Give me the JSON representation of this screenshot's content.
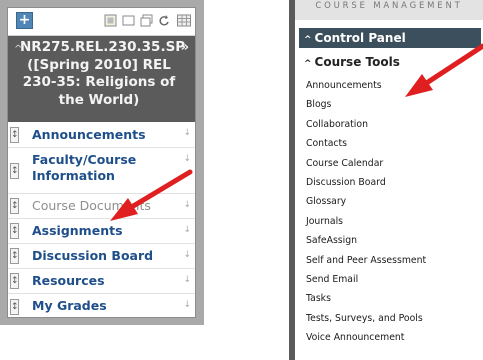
{
  "left_panel": {
    "toolbar": {
      "add_icon": "plus-icon",
      "icons": [
        "square-icon",
        "folder-icon",
        "refresh-icon",
        "grid-icon"
      ]
    },
    "course_title": "NR275.REL.230.35.SP ([Spring 2010] REL 230-35: Religions of the World)",
    "menu": [
      {
        "label": "Announcements",
        "muted": false
      },
      {
        "label": "Faculty/Course Information",
        "muted": false
      },
      {
        "label": "Course Documents",
        "muted": true
      },
      {
        "label": "Assignments",
        "muted": false
      },
      {
        "label": "Discussion Board",
        "muted": false
      },
      {
        "label": "Resources",
        "muted": false
      },
      {
        "label": "My Grades",
        "muted": false
      }
    ]
  },
  "right_panel": {
    "header": "COURSE MANAGEMENT",
    "control_panel": "Control Panel",
    "course_tools": "Course Tools",
    "tools": [
      "Announcements",
      "Blogs",
      "Collaboration",
      "Contacts",
      "Course Calendar",
      "Discussion Board",
      "Glossary",
      "Journals",
      "SafeAssign",
      "Self and Peer Assessment",
      "Send Email",
      "Tasks",
      "Tests, Surveys, and Pools",
      "Voice Announcement"
    ]
  },
  "colors": {
    "header_dark": "#5b5b5b",
    "link_blue": "#1f4f8a",
    "control_panel_bg": "#3c4f5c",
    "arrow_red": "#e02020"
  }
}
